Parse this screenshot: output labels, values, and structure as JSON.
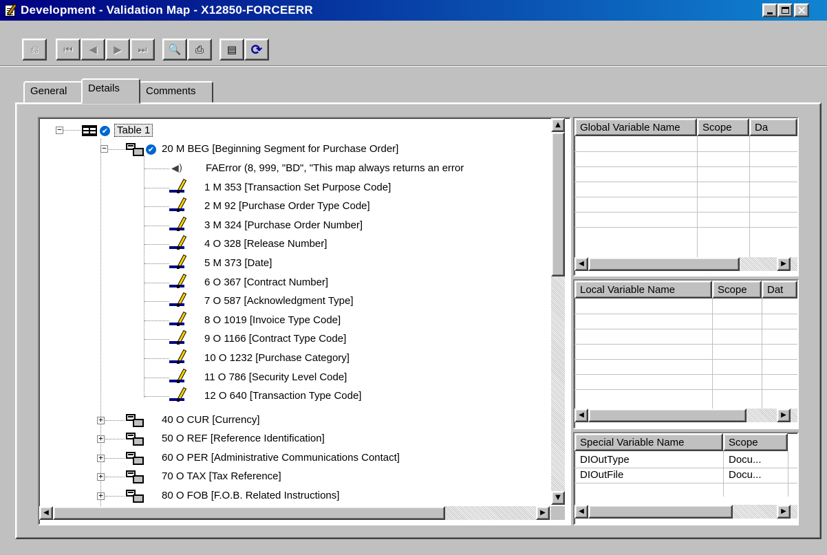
{
  "window": {
    "title": "Development - Validation Map - X12850-FORCEERR",
    "minimize_glyph": "",
    "maximize_glyph": "",
    "close_glyph": "✕"
  },
  "toolbar": {
    "buttons": [
      {
        "name": "exit-map-icon",
        "glyph": "⎌"
      },
      {
        "name": "first-record-icon",
        "glyph": "⏮"
      },
      {
        "name": "previous-record-icon",
        "glyph": "◀"
      },
      {
        "name": "next-record-icon",
        "glyph": "▶"
      },
      {
        "name": "last-record-icon",
        "glyph": "⏭"
      },
      {
        "name": "print-preview-icon",
        "glyph": "🔍"
      },
      {
        "name": "print-icon",
        "glyph": "⎙"
      },
      {
        "name": "notes-icon",
        "glyph": "▤"
      },
      {
        "name": "refresh-icon",
        "glyph": "⟳"
      }
    ]
  },
  "tabs": [
    {
      "label": "General",
      "active": false
    },
    {
      "label": "Details",
      "active": true
    },
    {
      "label": "Comments",
      "active": false
    }
  ],
  "tree": {
    "root": {
      "label": "Table 1",
      "icon": "table-icon",
      "status": "validated-check-icon",
      "expanded": true
    },
    "segment": {
      "label": "20 M BEG [Beginning Segment for Purchase Order]",
      "icon": "segment-icon",
      "status": "validated-check-icon",
      "expanded": true
    },
    "children": [
      {
        "label": "FAError (8, 999, \"BD\", \"This map always returns an error",
        "icon": "speaker-icon"
      },
      {
        "label": "1 M 353 [Transaction Set Purpose Code]",
        "icon": "element-icon"
      },
      {
        "label": "2 M 92 [Purchase Order Type Code]",
        "icon": "element-icon"
      },
      {
        "label": "3 M 324 [Purchase Order Number]",
        "icon": "element-icon"
      },
      {
        "label": "4 O 328 [Release Number]",
        "icon": "element-icon"
      },
      {
        "label": "5 M 373 [Date]",
        "icon": "element-icon"
      },
      {
        "label": "6 O 367 [Contract Number]",
        "icon": "element-icon"
      },
      {
        "label": "7 O 587 [Acknowledgment Type]",
        "icon": "element-icon"
      },
      {
        "label": "8 O 1019 [Invoice Type Code]",
        "icon": "element-icon"
      },
      {
        "label": "9 O 1166 [Contract Type Code]",
        "icon": "element-icon"
      },
      {
        "label": "10 O 1232 [Purchase Category]",
        "icon": "element-icon"
      },
      {
        "label": "11 O 786 [Security Level Code]",
        "icon": "element-icon"
      },
      {
        "label": "12 O 640 [Transaction Type Code]",
        "icon": "element-icon"
      }
    ],
    "siblings": [
      {
        "label": "40 O CUR [Currency]",
        "icon": "segment-icon",
        "expanded": false
      },
      {
        "label": "50 O REF [Reference Identification]",
        "icon": "segment-icon",
        "expanded": false
      },
      {
        "label": "60 O PER [Administrative Communications Contact]",
        "icon": "segment-icon",
        "expanded": false
      },
      {
        "label": "70 O TAX [Tax Reference]",
        "icon": "segment-icon",
        "expanded": false
      },
      {
        "label": "80 O FOB [F.O.B. Related Instructions]",
        "icon": "segment-icon",
        "expanded": false
      }
    ],
    "expand_glyph": "+",
    "collapse_glyph": "−"
  },
  "scroll": {
    "up": "▲",
    "down": "▼",
    "left": "◀",
    "right": "▶"
  },
  "global_vars": {
    "columns": [
      "Global Variable Name",
      "Scope",
      "Da"
    ],
    "rows": []
  },
  "local_vars": {
    "columns": [
      "Local Variable Name",
      "Scope",
      "Dat"
    ],
    "rows": []
  },
  "special_vars": {
    "columns": [
      "Special Variable Name",
      "Scope"
    ],
    "rows": [
      {
        "name": "DIOutType",
        "scope": "Docu..."
      },
      {
        "name": "DIOutFile",
        "scope": "Docu..."
      }
    ]
  }
}
